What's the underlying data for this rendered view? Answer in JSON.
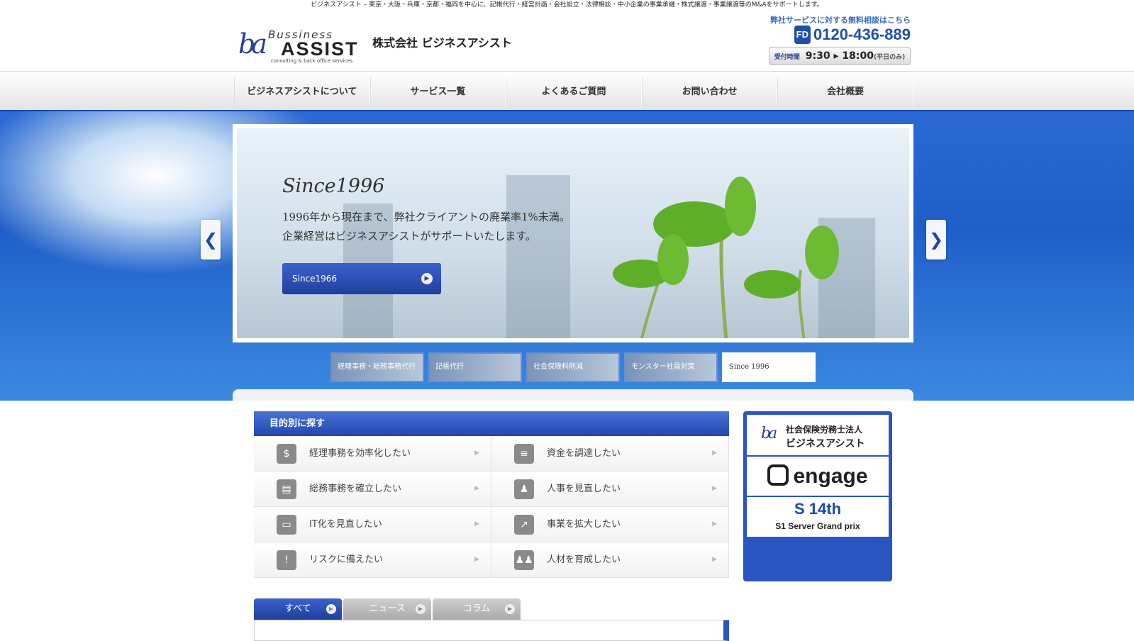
{
  "tagline": "ビジネスアシスト – 東京・大阪・兵庫・京都・福岡を中心に、記帳代行・経営計画・会社設立・法律相談・中小企業の事業承継・株式譲渡・事業譲渡等のM&Aをサポートします。",
  "logo": {
    "mark": "ba",
    "top": "Bussiness",
    "main": "ASSIST",
    "sub": "consulting & back office services"
  },
  "company_name": "株式会社 ビジネスアシスト",
  "contact": {
    "note": "弊社サービスに対する無料相談はこちら",
    "freedial": "FD",
    "tel": "0120-436-889",
    "hours_label": "受付時間",
    "hours": "9:30 ▸ 18:00",
    "hours_note": "(平日のみ)"
  },
  "nav": [
    "ビジネスアシストについて",
    "サービス一覧",
    "よくあるご質問",
    "お問い合わせ",
    "会社概要"
  ],
  "slider": {
    "title": "Since1996",
    "line1": "1996年から現在まで、弊社クライアントの廃業率1%未満。",
    "line2": "企業経営はビジネスアシストがサポートいたします。",
    "button": "Since1966",
    "prev": "❮",
    "next": "❯",
    "thumbs": [
      "経理事務・総務事務代行",
      "記帳代行",
      "社会保険料削減",
      "モンスター社員対策",
      "Since 1996"
    ],
    "active_thumb": 4
  },
  "purpose": {
    "heading": "目的別に探す",
    "items": [
      {
        "label": "経理事務を効率化したい",
        "icon": "money-bag-icon",
        "glyph": "$"
      },
      {
        "label": "資金を調達したい",
        "icon": "coins-icon",
        "glyph": "≡"
      },
      {
        "label": "総務事務を確立したい",
        "icon": "documents-icon",
        "glyph": "▤"
      },
      {
        "label": "人事を見直したい",
        "icon": "person-icon",
        "glyph": "♟"
      },
      {
        "label": "IT化を見直したい",
        "icon": "monitor-icon",
        "glyph": "▭"
      },
      {
        "label": "事業を拡大したい",
        "icon": "growth-chart-icon",
        "glyph": "↗"
      },
      {
        "label": "リスクに備えたい",
        "icon": "warning-icon",
        "glyph": "!"
      },
      {
        "label": "人材を育成したい",
        "icon": "group-icon",
        "glyph": "♟♟"
      }
    ]
  },
  "sidebar": {
    "card1_mark": "ba",
    "card1_line1": "社会保険労務士法人",
    "card1_line2": "ビジネスアシスト",
    "card2": "engage",
    "card3_num": "S 14th",
    "card3_text": "S1 Server Grand prix"
  },
  "news_tabs": [
    "すべて",
    "ニュース",
    "コラム"
  ],
  "colors": {
    "brand": "#2147ae",
    "accent": "#1d48a8"
  }
}
